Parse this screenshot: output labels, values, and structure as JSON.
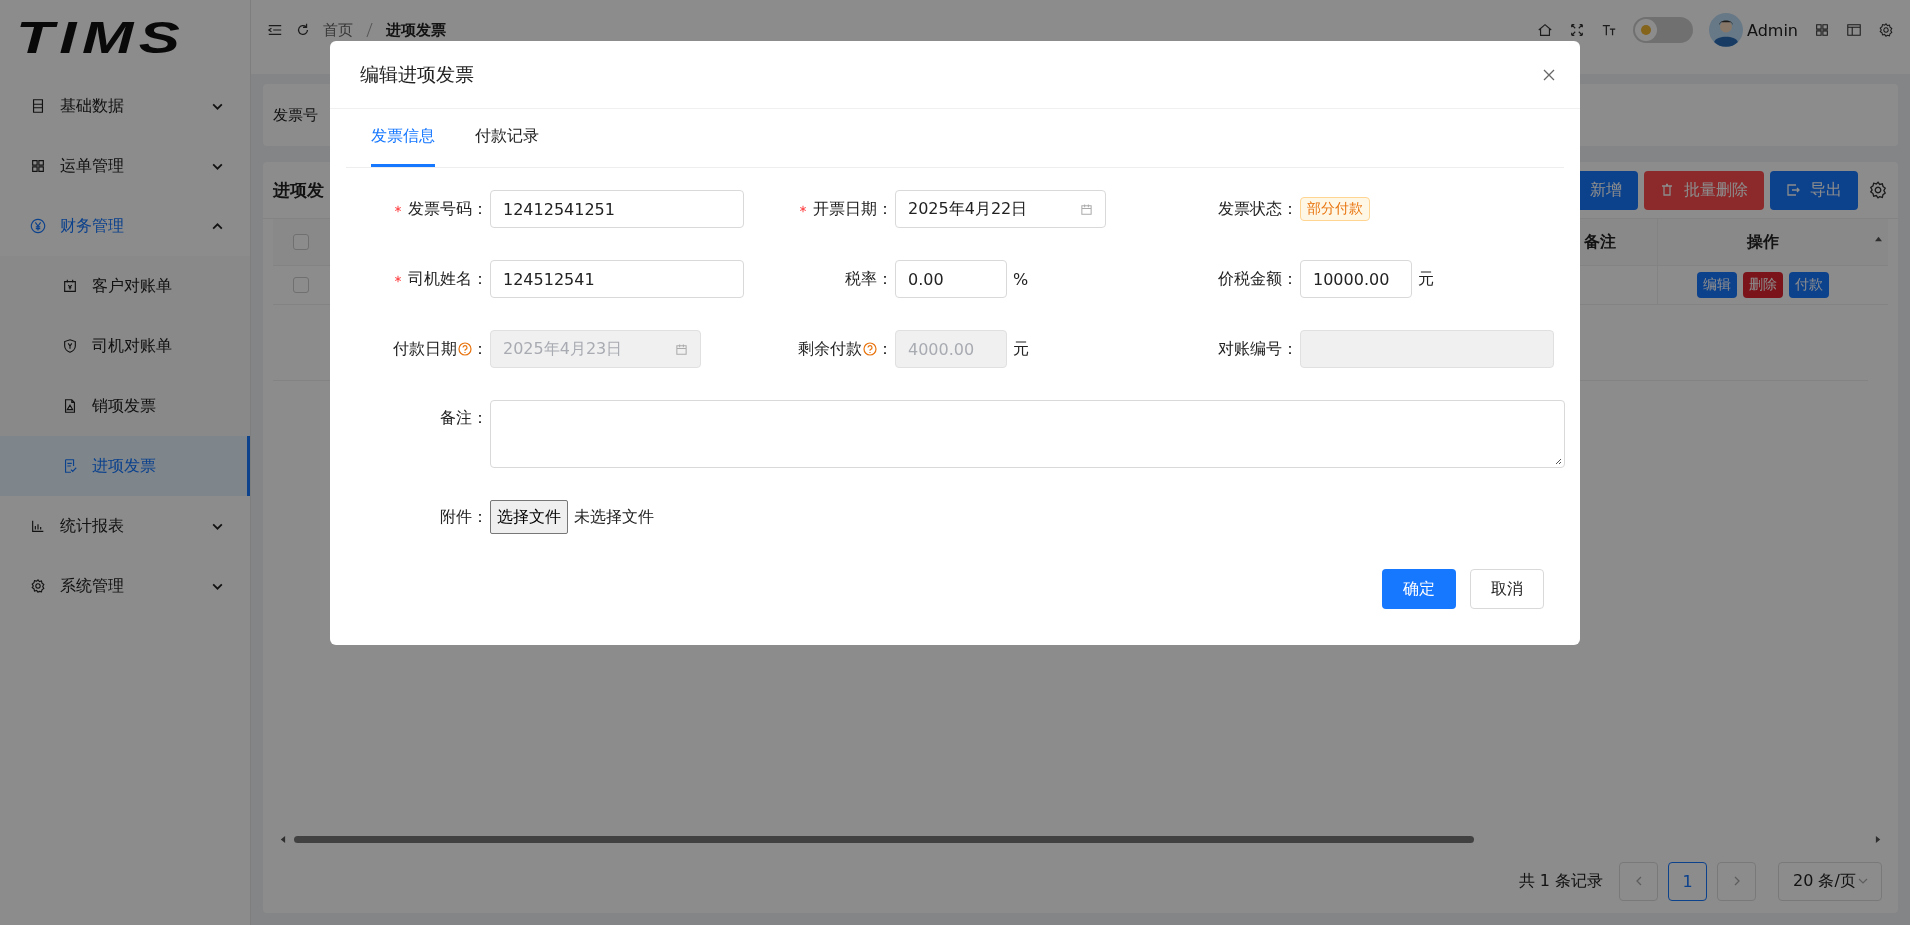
{
  "logo": "TIMS",
  "sidebar": {
    "items": [
      {
        "label": "基础数据",
        "selected": false,
        "expanded": false
      },
      {
        "label": "运单管理",
        "selected": false,
        "expanded": false
      },
      {
        "label": "财务管理",
        "selected": true,
        "expanded": true,
        "children": [
          {
            "label": "客户对账单",
            "selected": false
          },
          {
            "label": "司机对账单",
            "selected": false
          },
          {
            "label": "销项发票",
            "selected": false
          },
          {
            "label": "进项发票",
            "selected": true
          }
        ]
      },
      {
        "label": "统计报表",
        "selected": false,
        "expanded": false
      },
      {
        "label": "系统管理",
        "selected": false,
        "expanded": false
      }
    ]
  },
  "header": {
    "breadcrumb": [
      "首页",
      "进项发票"
    ],
    "theme_toggle": {
      "on": false
    },
    "user": "Admin"
  },
  "search": {
    "label": "发票号"
  },
  "table": {
    "title": "进项发",
    "toolbar": [
      {
        "label": "新增",
        "kind": "primary"
      },
      {
        "label": "批量删除",
        "kind": "danger"
      },
      {
        "label": "导出",
        "kind": "primary"
      }
    ],
    "header_checked": false,
    "columns": [
      "备注",
      "操作"
    ],
    "rows": [
      {
        "checked": false,
        "actions": [
          {
            "label": "编辑",
            "kind": "primary"
          },
          {
            "label": "删除",
            "kind": "danger"
          },
          {
            "label": "付款",
            "kind": "primary"
          }
        ]
      }
    ]
  },
  "pagination": {
    "total": "共 1 条记录",
    "pages": [
      {
        "label": "1",
        "selected": true
      }
    ],
    "page_size": "20 条/页"
  },
  "dialog": {
    "title": "编辑进项发票",
    "tabs": [
      {
        "label": "发票信息",
        "selected": true
      },
      {
        "label": "付款记录",
        "selected": false
      }
    ],
    "fields": [
      {
        "label": "发票号码",
        "colon": "：",
        "kind": "text",
        "required": true,
        "help": false,
        "disabled": false,
        "value": "12412541251"
      },
      {
        "label": "开票日期",
        "colon": "：",
        "kind": "date",
        "required": true,
        "help": false,
        "disabled": false,
        "value": "2025年4月22日"
      },
      {
        "label": "发票状态",
        "colon": "：",
        "kind": "tag",
        "required": false,
        "help": false,
        "value": "部分付款"
      },
      {
        "label": "司机姓名",
        "colon": "：",
        "kind": "text",
        "required": true,
        "help": false,
        "disabled": false,
        "value": "124512541"
      },
      {
        "label": "税率",
        "colon": "：",
        "kind": "number",
        "required": false,
        "help": false,
        "disabled": false,
        "value": "0.00",
        "unit": "%"
      },
      {
        "label": "价税金额",
        "colon": "：",
        "kind": "number",
        "required": false,
        "help": false,
        "disabled": false,
        "value": "10000.00",
        "unit": "元"
      },
      {
        "label": "付款日期",
        "colon": "：",
        "kind": "date",
        "required": false,
        "help": true,
        "disabled": true,
        "value": "2025年4月23日"
      },
      {
        "label": "剩余付款",
        "colon": "：",
        "kind": "number",
        "required": false,
        "help": true,
        "disabled": true,
        "value": "4000.00",
        "unit": "元"
      },
      {
        "label": "对账编号",
        "colon": "：",
        "kind": "text",
        "required": false,
        "help": false,
        "disabled": true
      }
    ],
    "remark": {
      "label": "备注",
      "colon": "："
    },
    "attachment": {
      "label": "附件",
      "colon": "：",
      "button": "选择文件",
      "status": "未选择文件"
    },
    "buttons": [
      {
        "label": "确定",
        "kind": "primary"
      },
      {
        "label": "取消",
        "kind": "default"
      }
    ]
  }
}
